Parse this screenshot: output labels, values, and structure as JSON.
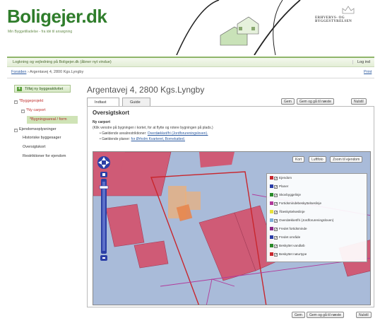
{
  "header": {
    "logo": "Boligejer.dk",
    "tagline": "Min Byggetilladelse - fra idé til ansøgning",
    "agency": "ERHVERVS- OG BYGGESTYRELSEN"
  },
  "topbar": {
    "guidance": "Logkning og vejledning på Boligejer.dk (åbner nyt vindue)",
    "login": "Log ind"
  },
  "breadcrumb": {
    "home": "Forsiden",
    "current": "› Argentavej 4, 2800 Kgs.Lyngby",
    "print": "Print"
  },
  "sidebar": {
    "add_button": "Tilføj ny byggeaktivitet",
    "items": [
      {
        "label": "*Byggeprojekt",
        "marker": "−"
      },
      {
        "label": "*Ny carport",
        "marker": "−"
      },
      {
        "label": "*Bygningsareal / form"
      },
      {
        "label": "Ejendomsoplysninger",
        "marker": "−"
      },
      {
        "label": "Historiske byggesager"
      },
      {
        "label": "Oversigtskort"
      },
      {
        "label": "Restriktioner for ejendom"
      }
    ]
  },
  "main": {
    "title": "Argentavej 4, 2800 Kgs.Lyngby",
    "tabs": [
      "Indtast",
      "Guide"
    ],
    "actions": {
      "save": "Gem",
      "save_next": "Gem og gå til næste",
      "reset": "Nulstil"
    },
    "section_title": "Oversigtskort",
    "subtitle": "Ny carport",
    "instruction": "(Klik venstre på bygningen i kortet, for at flytte og rotere bygningen på plads.)",
    "bullet1_label": "Gældende arealrestriktioner:",
    "bullet1_link": "Overdækket/fri (Jordforureningsloven).",
    "bullet2_label": "Gældende planer:",
    "bullet2_link": "for Ørholm Kvarteret, Bornekatted."
  },
  "map": {
    "buttons": {
      "kort": "Kort",
      "luftfoto": "Luftfoto",
      "zoom": "Zoom til ejendom"
    },
    "legend": [
      {
        "label": "Ejendom",
        "color": "#c8262d"
      },
      {
        "label": "Planer",
        "color": "#2a3da8"
      },
      {
        "label": "Skovbyggelinje",
        "color": "#2a8a2a"
      },
      {
        "label": "Fortidsmindebeskyttelseslinje",
        "color": "#b13a9b"
      },
      {
        "label": "Åbeskyttelseslinje",
        "color": "#e8e23a"
      },
      {
        "label": "Overdækket/fri (Jordforureningsloven)",
        "color": "#7fb0d8"
      },
      {
        "label": "Fredet fortidsminde",
        "color": "#8a2a8a"
      },
      {
        "label": "Fredet område",
        "color": "#2a3da8"
      },
      {
        "label": "Beskyttet vandløb",
        "color": "#2a8a2a"
      },
      {
        "label": "Beskyttet naturtype",
        "color": "#c8262d"
      }
    ]
  },
  "colors": {
    "brand": "#2f7d2b",
    "building": "#cf5b76",
    "map_bg": "#a9bbd9"
  }
}
